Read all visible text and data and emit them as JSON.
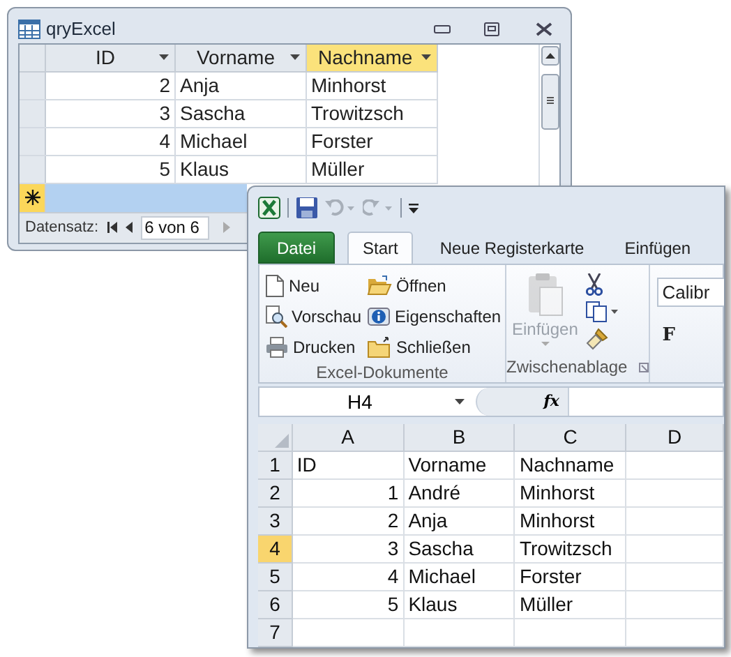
{
  "access_window": {
    "title": "qryExcel",
    "columns": [
      {
        "label": "ID",
        "selected": false
      },
      {
        "label": "Vorname",
        "selected": false
      },
      {
        "label": "Nachname",
        "selected": true
      }
    ],
    "rows": [
      {
        "cells": [
          "2",
          "Anja",
          "Minhorst"
        ]
      },
      {
        "cells": [
          "3",
          "Sascha",
          "Trowitzsch"
        ]
      },
      {
        "cells": [
          "4",
          "Michael",
          "Forster"
        ]
      },
      {
        "cells": [
          "5",
          "Klaus",
          "Müller"
        ]
      }
    ],
    "new_record": {
      "selected": true
    },
    "navigation": {
      "label": "Datensatz:",
      "record": "6 von 6"
    }
  },
  "excel_window": {
    "tabs": [
      {
        "label": "Datei",
        "kind": "file",
        "selected": false
      },
      {
        "label": "Start",
        "kind": "tab",
        "selected": true
      },
      {
        "label": "Neue Registerkarte",
        "kind": "tab",
        "selected": false
      },
      {
        "label": "Einfügen",
        "kind": "tab",
        "selected": false
      }
    ],
    "ribbon_groups": [
      {
        "label": "Excel-Dokumente",
        "buttons": [
          {
            "label": "Neu"
          },
          {
            "label": "Vorschau"
          },
          {
            "label": "Drucken"
          },
          {
            "label": "Öffnen"
          },
          {
            "label": "Eigenschaften"
          },
          {
            "label": "Schließen"
          }
        ]
      },
      {
        "label": "Zwischenablage",
        "paste": {
          "label": "Einfügen",
          "disabled": true
        }
      }
    ],
    "font": {
      "name": "Calibr",
      "bold_label": "F"
    },
    "name_box": "H4",
    "formula_label": "fx",
    "columns": [
      {
        "label": "A",
        "selected": false
      },
      {
        "label": "B",
        "selected": false
      },
      {
        "label": "C",
        "selected": false
      },
      {
        "label": "D",
        "selected": false
      }
    ],
    "rows": [
      {
        "label": "1",
        "selected": false,
        "cells": [
          "ID",
          "Vorname",
          "Nachname",
          ""
        ]
      },
      {
        "label": "2",
        "selected": false,
        "cells": [
          "1",
          "André",
          "Minhorst",
          ""
        ]
      },
      {
        "label": "3",
        "selected": false,
        "cells": [
          "2",
          "Anja",
          "Minhorst",
          ""
        ]
      },
      {
        "label": "4",
        "selected": true,
        "cells": [
          "3",
          "Sascha",
          "Trowitzsch",
          ""
        ]
      },
      {
        "label": "5",
        "selected": false,
        "cells": [
          "4",
          "Michael",
          "Forster",
          ""
        ]
      },
      {
        "label": "6",
        "selected": false,
        "cells": [
          "5",
          "Klaus",
          "Müller",
          ""
        ]
      },
      {
        "label": "7",
        "selected": false,
        "cells": [
          "",
          "",
          "",
          ""
        ]
      }
    ]
  }
}
